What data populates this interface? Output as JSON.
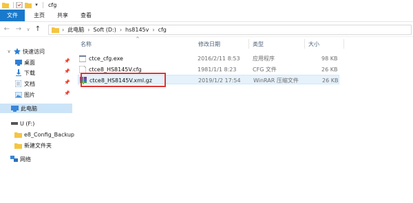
{
  "window": {
    "title": "cfg"
  },
  "ribbon": {
    "tabs": [
      "文件",
      "主页",
      "共享",
      "查看"
    ]
  },
  "address": {
    "crumbs": [
      "此电脑",
      "Soft (D:)",
      "hs8145v",
      "cfg"
    ]
  },
  "sidebar": {
    "items": [
      {
        "label": "快速访问",
        "icon": "star-icon"
      },
      {
        "label": "桌面",
        "icon": "desktop-icon"
      },
      {
        "label": "下载",
        "icon": "download-icon"
      },
      {
        "label": "文档",
        "icon": "document-icon"
      },
      {
        "label": "图片",
        "icon": "picture-icon"
      },
      {
        "label": "此电脑",
        "icon": "computer-icon"
      },
      {
        "label": "U (F:)",
        "icon": "usb-drive-icon"
      },
      {
        "label": "e8_Config_Backup",
        "icon": "folder-icon"
      },
      {
        "label": "新建文件夹",
        "icon": "folder-icon"
      },
      {
        "label": "网络",
        "icon": "network-icon"
      }
    ]
  },
  "columns": {
    "name": "名称",
    "date": "修改日期",
    "type": "类型",
    "size": "大小"
  },
  "files": [
    {
      "name": "ctce_cfg.exe",
      "date": "2016/2/11 8:53",
      "type": "应用程序",
      "size": "98 KB",
      "icon": "exe-icon"
    },
    {
      "name": "ctce8_HS8145V.cfg",
      "date": "1981/1/1 8:23",
      "type": "CFG 文件",
      "size": "26 KB",
      "icon": "cfg-file-icon"
    },
    {
      "name": "ctce8_HS8145V.xml.gz",
      "date": "2019/1/2 17:54",
      "type": "WinRAR 压缩文件",
      "size": "26 KB",
      "icon": "winrar-archive-icon"
    }
  ],
  "colors": {
    "accent": "#1979ca",
    "selection": "#cce4f7",
    "highlight_border": "#e33232",
    "folder": "#f5c542"
  }
}
